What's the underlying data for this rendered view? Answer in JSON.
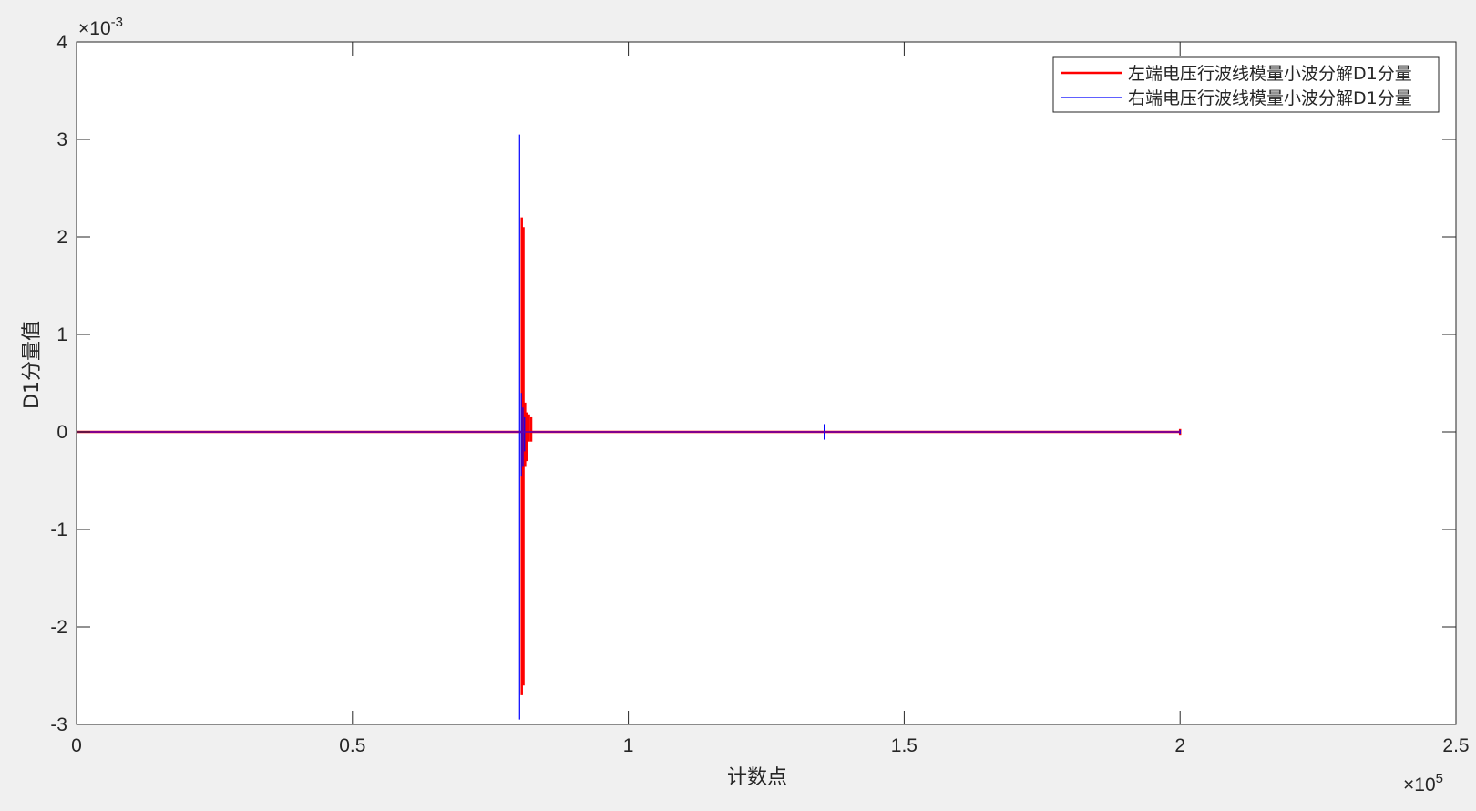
{
  "chart_data": {
    "type": "line",
    "title": "",
    "xlabel": "计数点",
    "ylabel": "D1分量值",
    "xlim": [
      0,
      250000
    ],
    "ylim": [
      -0.003,
      0.004
    ],
    "x_ticks": [
      0,
      0.5,
      1,
      1.5,
      2,
      2.5
    ],
    "x_tick_labels": [
      "0",
      "0.5",
      "1",
      "1.5",
      "2",
      "2.5"
    ],
    "x_exponent_label": "×10",
    "x_exponent_power": "5",
    "y_ticks": [
      -3,
      -2,
      -1,
      0,
      1,
      2,
      3,
      4
    ],
    "y_tick_labels": [
      "-3",
      "-2",
      "-1",
      "0",
      "1",
      "2",
      "3",
      "4"
    ],
    "y_exponent_label": "×10",
    "y_exponent_power": "-3",
    "grid": false,
    "legend_position": "top-right",
    "series": [
      {
        "name": "左端电压行波线模量小波分解D1分量",
        "color": "#ff0000",
        "line_width": 2.5,
        "x_end": 200000,
        "spikes": [
          {
            "x": 80700,
            "max": 0.0022,
            "min": -0.0027
          },
          {
            "x": 81000,
            "max": 0.0021,
            "min": -0.0026
          },
          {
            "x": 81300,
            "max": 0.0003,
            "min": -0.00035
          },
          {
            "x": 81600,
            "max": 0.0002,
            "min": -0.0003
          },
          {
            "x": 82000,
            "max": 0.00018,
            "min": -0.0001
          },
          {
            "x": 82400,
            "max": 0.00015,
            "min": -0.0001
          },
          {
            "x": 200000,
            "max": 3e-05,
            "min": -3e-05
          }
        ]
      },
      {
        "name": "右端电压行波线模量小波分解D1分量",
        "color": "#0000ff",
        "line_width": 1.2,
        "x_end": 200000,
        "spikes": [
          {
            "x": 80300,
            "max": 0.00305,
            "min": -0.00295
          },
          {
            "x": 80600,
            "max": 0.0004,
            "min": -0.00045
          },
          {
            "x": 80900,
            "max": 0.00025,
            "min": -0.00035
          },
          {
            "x": 81200,
            "max": 0.00015,
            "min": -0.0002
          },
          {
            "x": 135500,
            "max": 8e-05,
            "min": -8e-05
          },
          {
            "x": 200000,
            "max": 2e-05,
            "min": -2e-05
          }
        ]
      }
    ]
  }
}
